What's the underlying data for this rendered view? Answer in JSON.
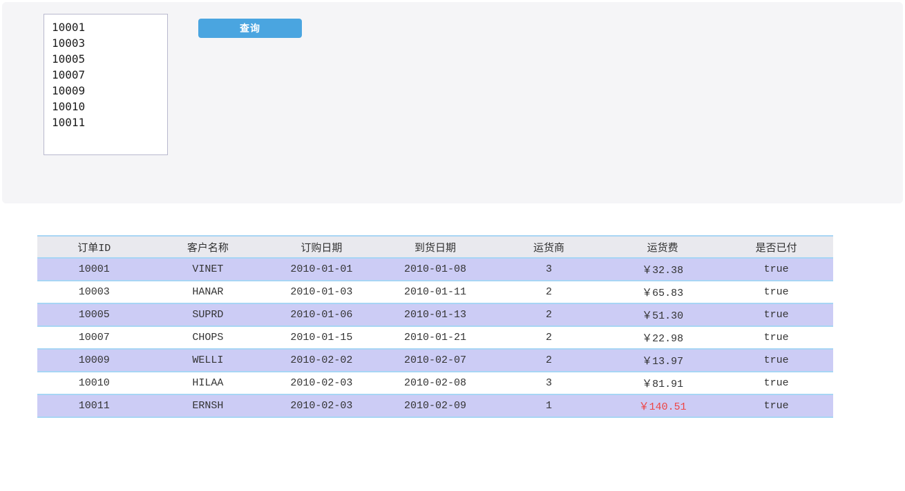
{
  "query_panel": {
    "order_id_listbox": {
      "items": [
        "10001",
        "10003",
        "10005",
        "10007",
        "10009",
        "10010",
        "10011"
      ]
    },
    "query_button_label": "查询"
  },
  "orders_table": {
    "columns": {
      "order_id": "订单ID",
      "customer": "客户名称",
      "order_date": "订购日期",
      "delivery_date": "到货日期",
      "shipper": "运货商",
      "freight": "运货费",
      "paid": "是否已付"
    },
    "rows": [
      {
        "order_id": "10001",
        "customer": "VINET",
        "order_date": "2010-01-01",
        "delivery_date": "2010-01-08",
        "shipper": "3",
        "freight": "￥32.38",
        "paid": "true"
      },
      {
        "order_id": "10003",
        "customer": "HANAR",
        "order_date": "2010-01-03",
        "delivery_date": "2010-01-11",
        "shipper": "2",
        "freight": "￥65.83",
        "paid": "true"
      },
      {
        "order_id": "10005",
        "customer": "SUPRD",
        "order_date": "2010-01-06",
        "delivery_date": "2010-01-13",
        "shipper": "2",
        "freight": "￥51.30",
        "paid": "true"
      },
      {
        "order_id": "10007",
        "customer": "CHOPS",
        "order_date": "2010-01-15",
        "delivery_date": "2010-01-21",
        "shipper": "2",
        "freight": "￥22.98",
        "paid": "true"
      },
      {
        "order_id": "10009",
        "customer": "WELLI",
        "order_date": "2010-02-02",
        "delivery_date": "2010-02-07",
        "shipper": "2",
        "freight": "￥13.97",
        "paid": "true"
      },
      {
        "order_id": "10010",
        "customer": "HILAA",
        "order_date": "2010-02-03",
        "delivery_date": "2010-02-08",
        "shipper": "3",
        "freight": "￥81.91",
        "paid": "true"
      },
      {
        "order_id": "10011",
        "customer": "ERNSH",
        "order_date": "2010-02-03",
        "delivery_date": "2010-02-09",
        "shipper": "1",
        "freight": "￥140.51",
        "paid": "true"
      }
    ]
  },
  "colors": {
    "panel_background": "#f5f5f7",
    "button_blue": "#4aa5e0",
    "header_background": "#e9e9ee",
    "row_stripe_lavender": "#ccccf5",
    "row_border_blue": "#a7d5f4",
    "freight_alert_red": "#ee4444"
  }
}
